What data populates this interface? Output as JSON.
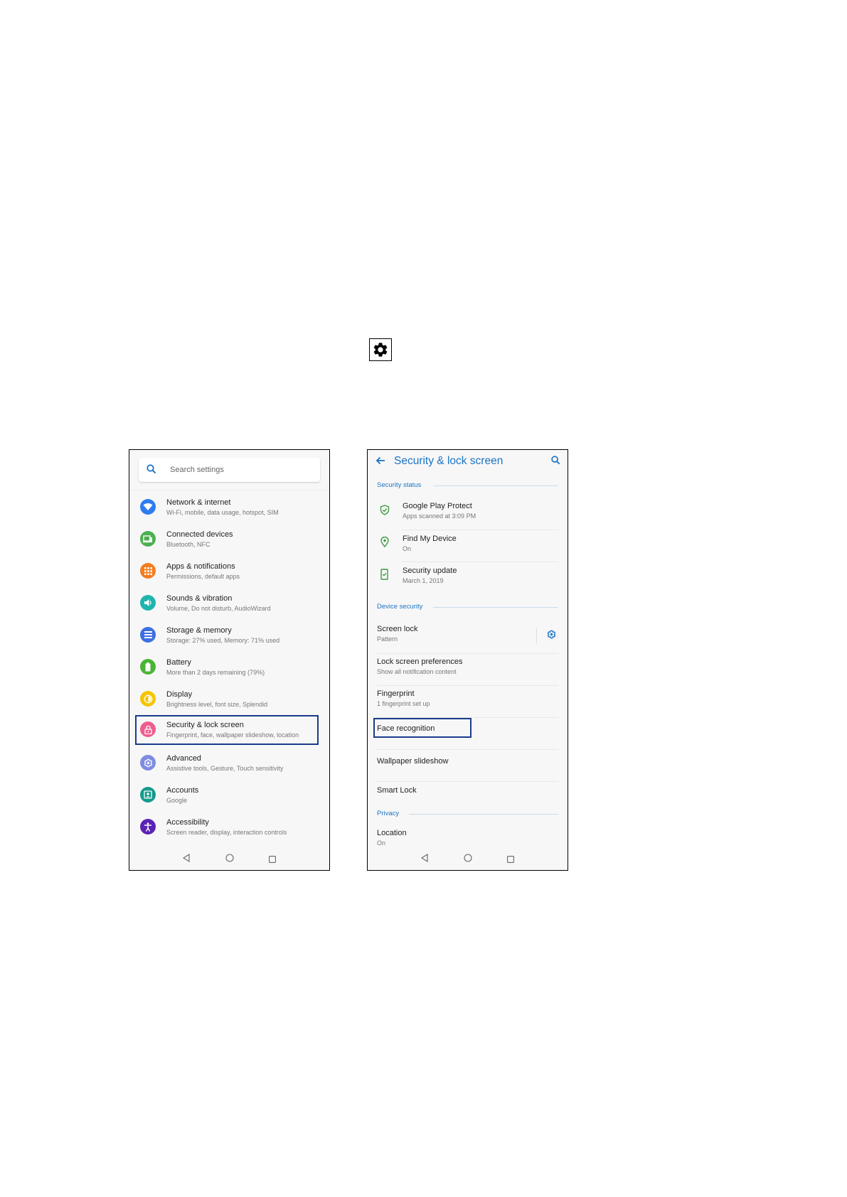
{
  "colors": {
    "accent": "#1b74c4",
    "highlight_border": "#1a3b8c",
    "screen_bg": "#f7f7f7"
  },
  "settings_screen": {
    "search_placeholder": "Search settings",
    "items": [
      {
        "title": "Network & internet",
        "subtitle": "Wi-Fi, mobile, data usage, hotspot, SIM",
        "icon": "wifi-icon",
        "color": "#2f7cf0"
      },
      {
        "title": "Connected devices",
        "subtitle": "Bluetooth, NFC",
        "icon": "devices-icon",
        "color": "#4caf50"
      },
      {
        "title": "Apps & notifications",
        "subtitle": "Permissions, default apps",
        "icon": "apps-icon",
        "color": "#f57c1f"
      },
      {
        "title": "Sounds & vibration",
        "subtitle": "Volume, Do not disturb, AudioWizard",
        "icon": "volume-icon",
        "color": "#1fb5ae"
      },
      {
        "title": "Storage & memory",
        "subtitle": "Storage: 27% used, Memory: 71% used",
        "icon": "storage-icon",
        "color": "#3d6fe0"
      },
      {
        "title": "Battery",
        "subtitle": "More than 2 days remaining (79%)",
        "icon": "battery-icon",
        "color": "#4bb436"
      },
      {
        "title": "Display",
        "subtitle": "Brightness level, font size, Splendid",
        "icon": "brightness-icon",
        "color": "#f5c400"
      },
      {
        "title": "Security & lock screen",
        "subtitle": "Fingerprint, face, wallpaper slideshow, location",
        "icon": "lock-icon",
        "color": "#ef5d8f"
      },
      {
        "title": "Advanced",
        "subtitle": "Assistive tools, Gesture, Touch sensitivity",
        "icon": "settings-gear-icon",
        "color": "#7e8ce0"
      },
      {
        "title": "Accounts",
        "subtitle": "Google",
        "icon": "account-icon",
        "color": "#159a8c"
      },
      {
        "title": "Accessibility",
        "subtitle": "Screen reader, display, interaction controls",
        "icon": "accessibility-icon",
        "color": "#5a22b5"
      }
    ]
  },
  "security_screen": {
    "title": "Security & lock screen",
    "sections": {
      "security_status": "Security status",
      "device_security": "Device security",
      "privacy": "Privacy"
    },
    "status_items": [
      {
        "title": "Google Play Protect",
        "subtitle": "Apps scanned at 3:09 PM",
        "icon": "shield-check-icon"
      },
      {
        "title": "Find My Device",
        "subtitle": "On",
        "icon": "location-pin-icon"
      },
      {
        "title": "Security update",
        "subtitle": "March 1, 2019",
        "icon": "phone-update-icon"
      }
    ],
    "device_items": [
      {
        "title": "Screen lock",
        "subtitle": "Pattern"
      },
      {
        "title": "Lock screen preferences",
        "subtitle": "Show all notification content"
      },
      {
        "title": "Fingerprint",
        "subtitle": "1 fingerprint set up"
      },
      {
        "title": "Face recognition",
        "subtitle": ""
      },
      {
        "title": "Wallpaper slideshow",
        "subtitle": ""
      },
      {
        "title": "Smart Lock",
        "subtitle": ""
      }
    ],
    "privacy_items": [
      {
        "title": "Location",
        "subtitle": "On"
      }
    ]
  }
}
